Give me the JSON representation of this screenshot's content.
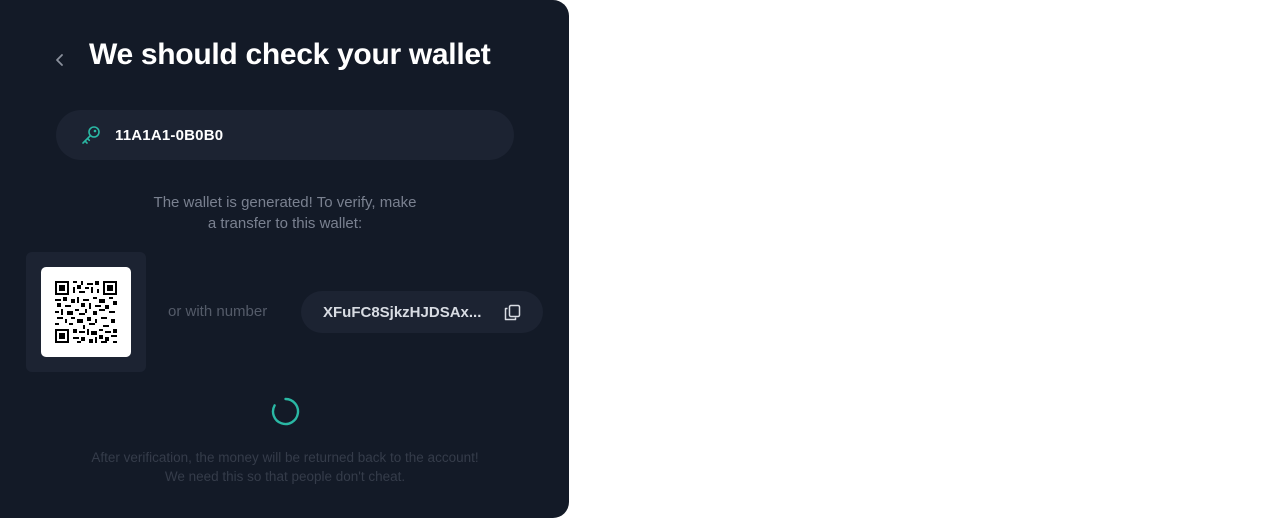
{
  "header": {
    "title": "We should check your wallet",
    "back_icon": "chevron-left-icon"
  },
  "wallet_id": {
    "icon": "key-icon",
    "value": "11A1A1-0B0B0"
  },
  "instruction": {
    "line1": "The wallet is generated! To verify, make",
    "line2": "a transfer to this wallet:"
  },
  "qr": {
    "icon": "qr-code-icon"
  },
  "alternative": {
    "label": "or with number",
    "address": "XFuFC8SjkzHJDSAx...",
    "copy_icon": "copy-icon"
  },
  "status": {
    "spinner_icon": "loading-spinner-icon"
  },
  "footnote": {
    "line1": "After verification, the money will be returned back to the account!",
    "line2": "We need this so that people don't cheat."
  },
  "colors": {
    "panel_background": "#131a27",
    "field_background": "#1c2332",
    "accent": "#2ab8a4",
    "title_text": "#ffffff",
    "muted_text": "#7a8190"
  }
}
